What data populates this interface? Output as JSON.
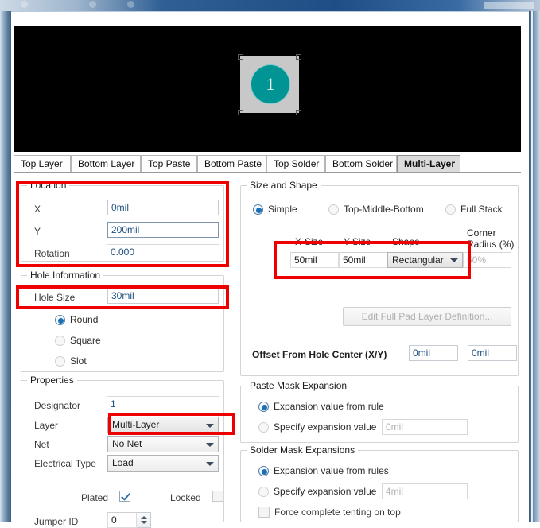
{
  "preview": {
    "designator_text": "1",
    "pad_color": "#c8c8c8",
    "hole_color": "#009494",
    "background_color": "#000000"
  },
  "tabs": [
    {
      "label": "Top Layer",
      "active": false
    },
    {
      "label": "Bottom Layer",
      "active": false
    },
    {
      "label": "Top Paste",
      "active": false
    },
    {
      "label": "Bottom Paste",
      "active": false
    },
    {
      "label": "Top Solder",
      "active": false
    },
    {
      "label": "Bottom Solder",
      "active": false
    },
    {
      "label": "Multi-Layer",
      "active": true
    }
  ],
  "location": {
    "legend": "Location",
    "x_label": "X",
    "x_value": "0mil",
    "y_label": "Y",
    "y_value": "200mil",
    "rotation_label": "Rotation",
    "rotation_value": "0.000"
  },
  "hole_information": {
    "legend": "Hole Information",
    "hole_size_label": "Hole Size",
    "hole_size_value": "30mil",
    "shapes": [
      {
        "label": "Round",
        "accel": "R",
        "selected": true
      },
      {
        "label": "Square",
        "accel": "",
        "selected": false
      },
      {
        "label": "Slot",
        "accel": "",
        "selected": false
      }
    ]
  },
  "properties": {
    "legend": "Properties",
    "designator_label": "Designator",
    "designator_value": "1",
    "layer_label": "Layer",
    "layer_value": "Multi-Layer",
    "net_label": "Net",
    "net_value": "No Net",
    "electrical_type_label": "Electrical Type",
    "electrical_type_value": "Load",
    "plated_label": "Plated",
    "plated_checked": true,
    "locked_label": "Locked",
    "locked_checked": false,
    "jumper_id_label": "Jumper ID",
    "jumper_id_value": "0"
  },
  "size_and_shape": {
    "legend": "Size and Shape",
    "modes": [
      {
        "label": "Simple",
        "selected": true
      },
      {
        "label": "Top-Middle-Bottom",
        "selected": false
      },
      {
        "label": "Full Stack",
        "selected": false
      }
    ],
    "columns": {
      "x_size": "X-Size",
      "y_size": "Y-Size",
      "shape": "Shape",
      "corner_radius": "Corner\nRadius (%)",
      "corner_radius_line1": "Corner",
      "corner_radius_line2": "Radius (%)"
    },
    "x_size_value": "50mil",
    "y_size_value": "50mil",
    "shape_value": "Rectangular",
    "corner_radius_value": "50%",
    "edit_full_pad_button": "Edit Full Pad Layer Definition...",
    "offset_label": "Offset From Hole Center (X/Y)",
    "offset_x_value": "0mil",
    "offset_y_value": "0mil"
  },
  "paste_mask": {
    "legend": "Paste Mask Expansion",
    "from_rule_label": "Expansion value from rule",
    "from_rule_selected": true,
    "specify_label": "Specify expansion value",
    "specify_selected": false,
    "specify_value": "0mil"
  },
  "solder_mask": {
    "legend": "Solder Mask Expansions",
    "from_rules_label": "Expansion value from rules",
    "from_rules_selected": true,
    "specify_label": "Specify expansion value",
    "specify_selected": false,
    "specify_value": "4mil",
    "force_tenting_label": "Force complete tenting on top",
    "force_tenting_checked": false
  },
  "highlight_color": "#ee0000"
}
